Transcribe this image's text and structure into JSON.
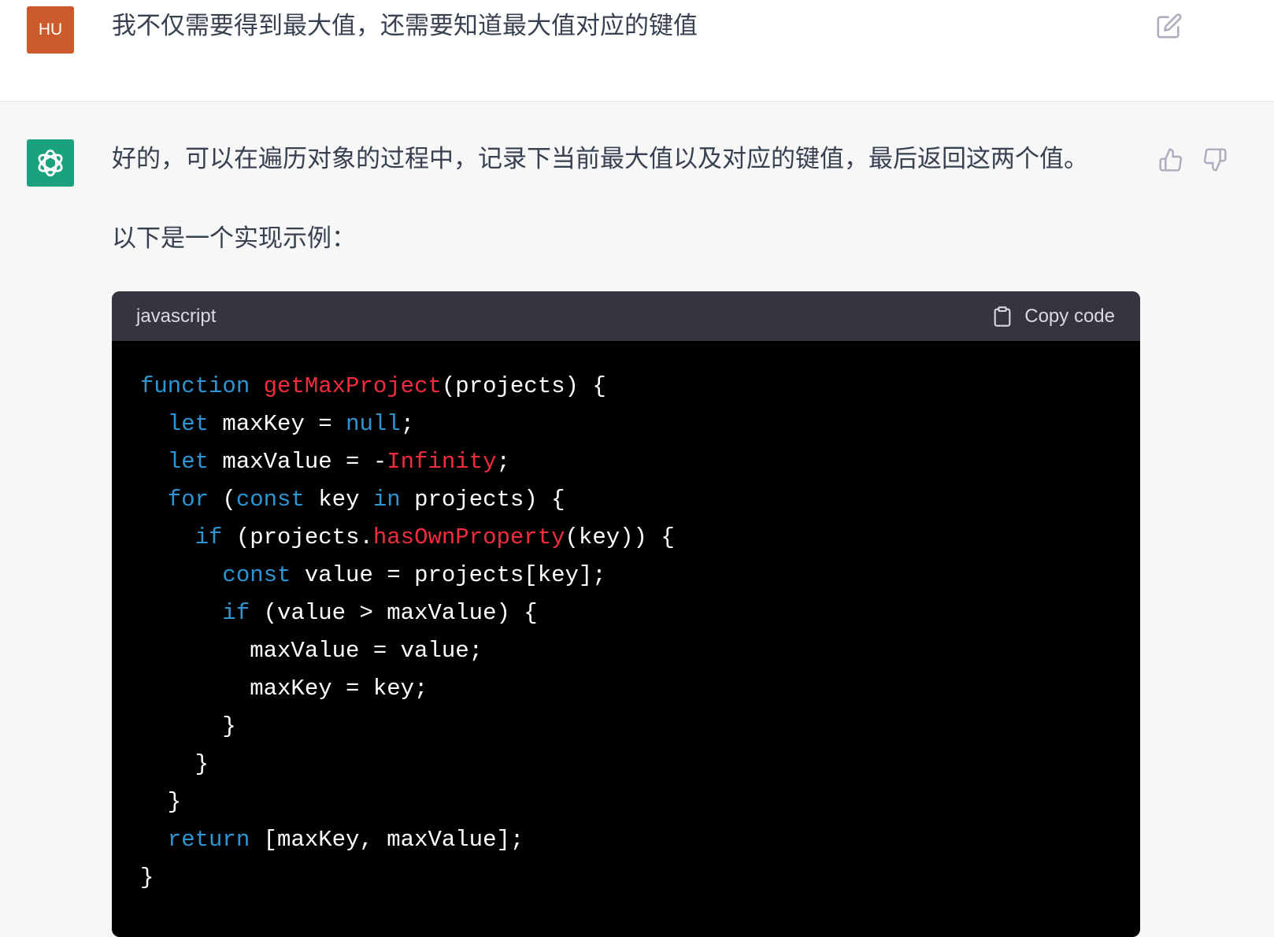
{
  "user_message": {
    "avatar_initials": "HU",
    "text": "我不仅需要得到最大值，还需要知道最大值对应的键值",
    "edit_icon": "edit-icon"
  },
  "assistant_message": {
    "avatar_icon": "openai-logo-icon",
    "paragraph_1": "好的，可以在遍历对象的过程中，记录下当前最大值以及对应的键值，最后返回这两个值。",
    "paragraph_2": "以下是一个实现示例：",
    "feedback_icons": [
      "thumbs-up-icon",
      "thumbs-down-icon"
    ]
  },
  "code_block": {
    "language": "javascript",
    "copy_label": "Copy code",
    "copy_icon": "clipboard-icon",
    "lines": [
      [
        [
          "kw",
          "function"
        ],
        [
          "plain",
          " "
        ],
        [
          "fn",
          "getMaxProject"
        ],
        [
          "plain",
          "(projects) {"
        ]
      ],
      [
        [
          "plain",
          "  "
        ],
        [
          "kw",
          "let"
        ],
        [
          "plain",
          " maxKey = "
        ],
        [
          "kw",
          "null"
        ],
        [
          "plain",
          ";"
        ]
      ],
      [
        [
          "plain",
          "  "
        ],
        [
          "kw",
          "let"
        ],
        [
          "plain",
          " maxValue = -"
        ],
        [
          "fn",
          "Infinity"
        ],
        [
          "plain",
          ";"
        ]
      ],
      [
        [
          "plain",
          "  "
        ],
        [
          "kw",
          "for"
        ],
        [
          "plain",
          " ("
        ],
        [
          "kw",
          "const"
        ],
        [
          "plain",
          " key "
        ],
        [
          "kw",
          "in"
        ],
        [
          "plain",
          " projects) {"
        ]
      ],
      [
        [
          "plain",
          "    "
        ],
        [
          "kw",
          "if"
        ],
        [
          "plain",
          " (projects."
        ],
        [
          "fn",
          "hasOwnProperty"
        ],
        [
          "plain",
          "(key)) {"
        ]
      ],
      [
        [
          "plain",
          "      "
        ],
        [
          "kw",
          "const"
        ],
        [
          "plain",
          " value = projects[key];"
        ]
      ],
      [
        [
          "plain",
          "      "
        ],
        [
          "kw",
          "if"
        ],
        [
          "plain",
          " (value > maxValue) {"
        ]
      ],
      [
        [
          "plain",
          "        maxValue = value;"
        ]
      ],
      [
        [
          "plain",
          "        maxKey = key;"
        ]
      ],
      [
        [
          "plain",
          "      }"
        ]
      ],
      [
        [
          "plain",
          "    }"
        ]
      ],
      [
        [
          "plain",
          "  }"
        ]
      ],
      [
        [
          "plain",
          "  "
        ],
        [
          "kw",
          "return"
        ],
        [
          "plain",
          " [maxKey, maxValue];"
        ]
      ],
      [
        [
          "plain",
          "}"
        ]
      ]
    ]
  },
  "colors": {
    "user_avatar": "#cc5a2c",
    "assistant_avatar": "#19a27d",
    "code_keyword": "#2e95d3",
    "code_function": "#f22c3d",
    "code_header_bg": "#343541",
    "code_bg": "#000000"
  }
}
